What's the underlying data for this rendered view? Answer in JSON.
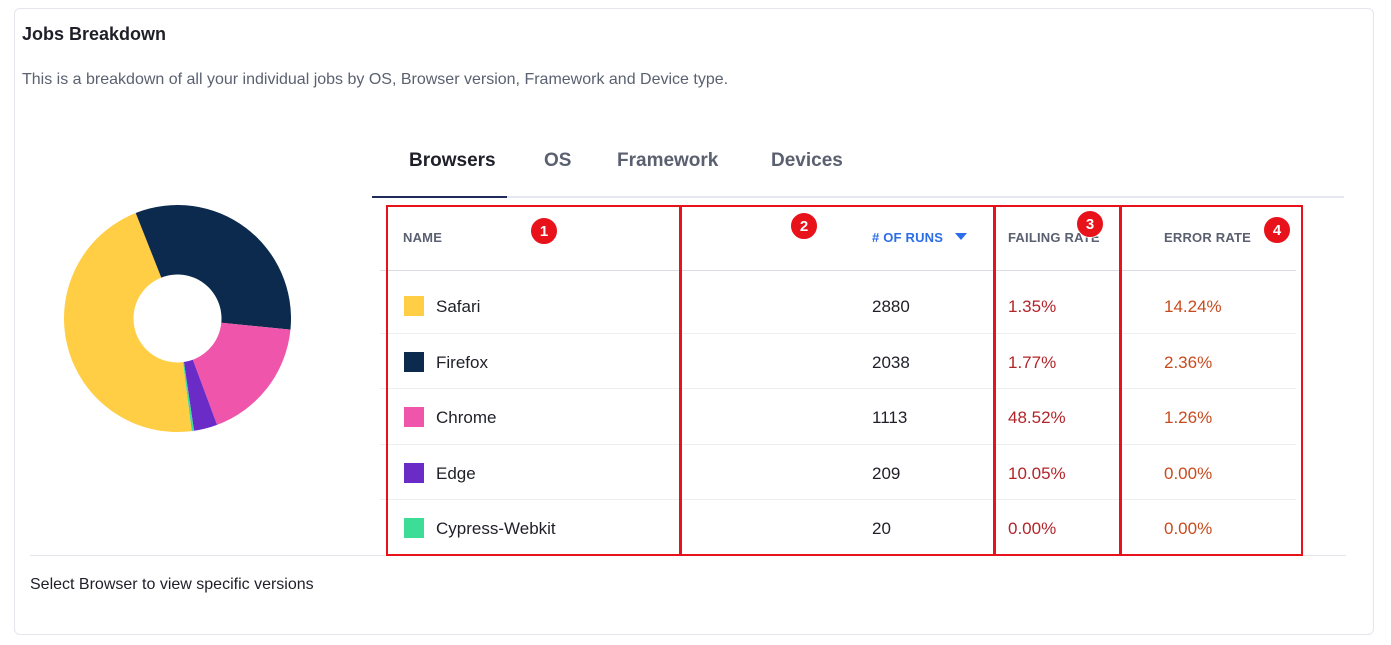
{
  "card": {
    "title": "Jobs Breakdown",
    "description": "This is a breakdown of all your individual jobs by OS, Browser version, Framework and Device type."
  },
  "tabs": [
    {
      "label": "Browsers",
      "active": true
    },
    {
      "label": "OS",
      "active": false
    },
    {
      "label": "Framework",
      "active": false
    },
    {
      "label": "Devices",
      "active": false
    }
  ],
  "table": {
    "columns": {
      "name": "NAME",
      "runs": "# OF RUNS",
      "failing": "FAILING RATE",
      "error": "ERROR RATE"
    },
    "sorted_column": "runs",
    "rows": [
      {
        "name": "Safari",
        "color": "#FFCE45",
        "runs": "2880",
        "failing": "1.35%",
        "error": "14.24%"
      },
      {
        "name": "Firefox",
        "color": "#0B2A4E",
        "runs": "2038",
        "failing": "1.77%",
        "error": "2.36%"
      },
      {
        "name": "Chrome",
        "color": "#EF55AA",
        "runs": "1113",
        "failing": "48.52%",
        "error": "1.26%"
      },
      {
        "name": "Edge",
        "color": "#6A2BC6",
        "runs": "209",
        "failing": "10.05%",
        "error": "0.00%"
      },
      {
        "name": "Cypress-Webkit",
        "color": "#3DDC97",
        "runs": "20",
        "failing": "0.00%",
        "error": "0.00%"
      }
    ]
  },
  "chart_data": {
    "type": "pie",
    "categories": [
      "Safari",
      "Firefox",
      "Chrome",
      "Edge",
      "Cypress-Webkit"
    ],
    "values": [
      2880,
      2038,
      1113,
      209,
      20
    ],
    "colors": [
      "#FFCE45",
      "#0B2A4E",
      "#EF55AA",
      "#6A2BC6",
      "#3DDC97"
    ],
    "donut": true
  },
  "annotations": [
    "1",
    "2",
    "3",
    "4"
  ],
  "footer": {
    "text": "Select Browser to view specific versions"
  }
}
